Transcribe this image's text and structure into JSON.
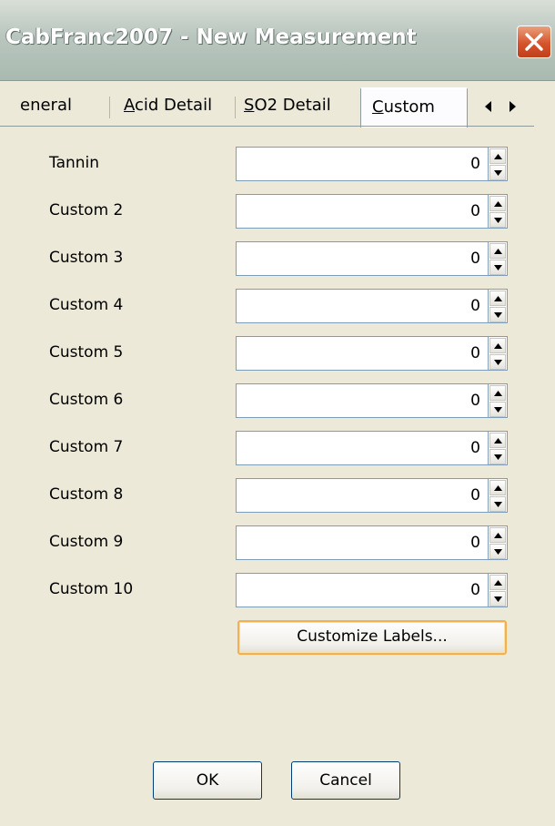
{
  "window": {
    "title": "CabFranc2007 - New Measurement",
    "close_icon": "close-icon"
  },
  "tabs": [
    {
      "label_pre": "",
      "label_ul": "",
      "label_post": "eneral",
      "active": false
    },
    {
      "label_pre": "",
      "label_ul": "A",
      "label_post": "cid Detail",
      "active": false
    },
    {
      "label_pre": "",
      "label_ul": "S",
      "label_post": "O2 Detail",
      "active": false
    },
    {
      "label_pre": "",
      "label_ul": "C",
      "label_post": "ustom",
      "active": true
    }
  ],
  "fields": [
    {
      "label": "Tannin",
      "value": "0"
    },
    {
      "label": "Custom 2",
      "value": "0"
    },
    {
      "label": "Custom 3",
      "value": "0"
    },
    {
      "label": "Custom 4",
      "value": "0"
    },
    {
      "label": "Custom 5",
      "value": "0"
    },
    {
      "label": "Custom 6",
      "value": "0"
    },
    {
      "label": "Custom 7",
      "value": "0"
    },
    {
      "label": "Custom 8",
      "value": "0"
    },
    {
      "label": "Custom 9",
      "value": "0"
    },
    {
      "label": "Custom 10",
      "value": "0"
    }
  ],
  "buttons": {
    "customize": "Customize Labels...",
    "ok": "OK",
    "cancel": "Cancel"
  },
  "colors": {
    "dialog_bg": "#ece9d8",
    "close_red": "#d6542c",
    "focus_orange": "#f3b052"
  }
}
